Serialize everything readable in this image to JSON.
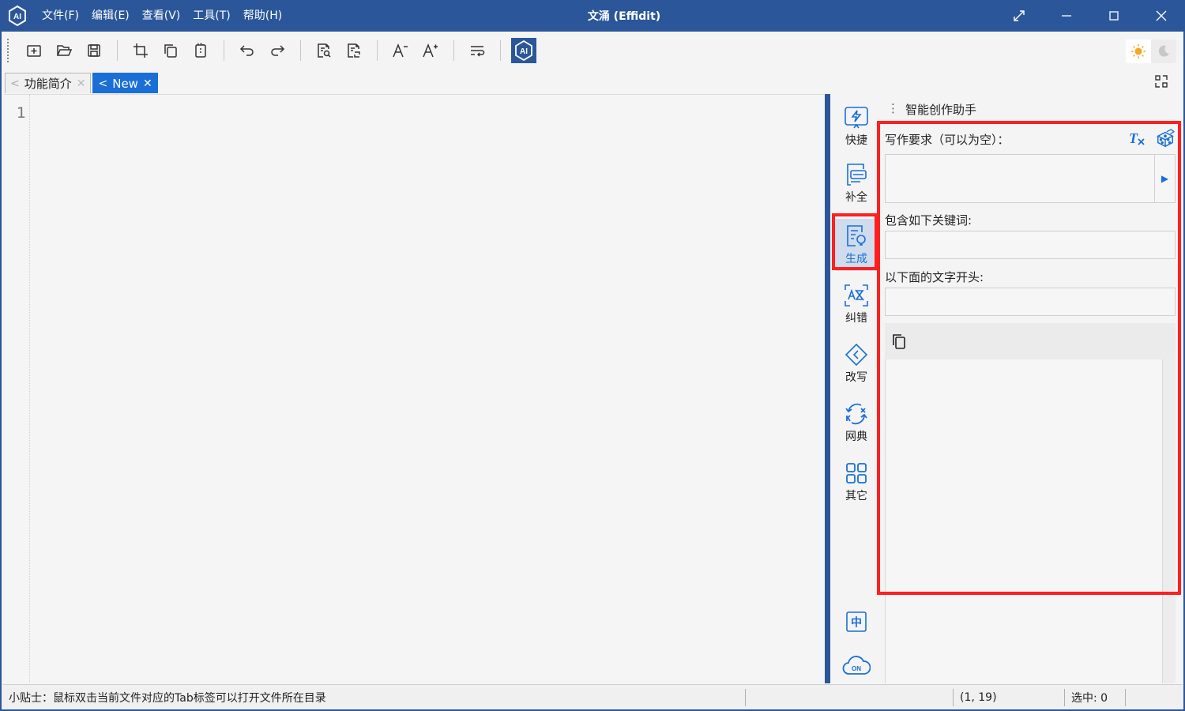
{
  "app": {
    "title": "文涌 (Effidit)",
    "logo_text": "AI"
  },
  "menu": [
    "文件(F)",
    "编辑(E)",
    "查看(V)",
    "工具(T)",
    "帮助(H)"
  ],
  "tabs": [
    {
      "label": "功能简介",
      "active": false
    },
    {
      "label": "New",
      "active": true
    }
  ],
  "editor": {
    "line_number": "1"
  },
  "sidenav": {
    "items": [
      {
        "label": "快捷",
        "icon": "lightning-icon"
      },
      {
        "label": "补全",
        "icon": "complete-icon"
      },
      {
        "label": "生成",
        "icon": "generate-icon",
        "active": true
      },
      {
        "label": "纠错",
        "icon": "correct-icon"
      },
      {
        "label": "改写",
        "icon": "rewrite-icon"
      },
      {
        "label": "网典",
        "icon": "dictionary-icon"
      },
      {
        "label": "其它",
        "icon": "grid-icon"
      }
    ],
    "bottom_icons": {
      "lang": "中",
      "cloud": "ON"
    }
  },
  "panel": {
    "title": "智能创作助手",
    "requirement_label": "写作要求（可以为空）：",
    "keywords_label": "包含如下关键词:",
    "start_label": "以下面的文字开头:",
    "requirement_value": "",
    "keywords_value": "",
    "start_value": ""
  },
  "status": {
    "tip": "小贴士：鼠标双击当前文件对应的Tab标签可以打开文件所在目录",
    "position": "(1, 19)",
    "selection": "选中: 0"
  },
  "colors": {
    "titlebar": "#2b579a",
    "accent": "#1a6fd6",
    "highlight": "#ff1f1f"
  }
}
